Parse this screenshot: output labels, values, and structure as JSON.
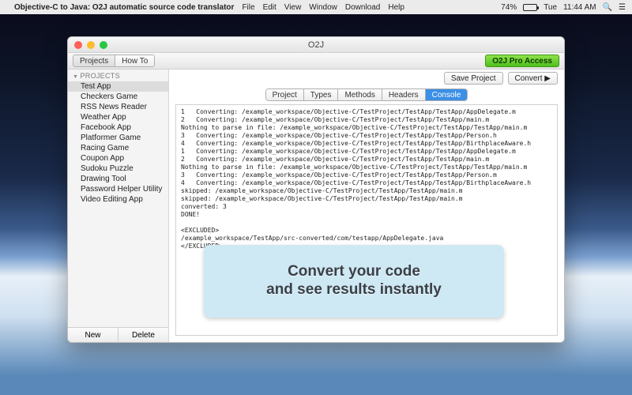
{
  "menubar": {
    "app_title": "Objective-C to Java: O2J automatic source code translator",
    "items": [
      "File",
      "Edit",
      "View",
      "Window",
      "Download",
      "Help"
    ],
    "battery_pct": "74%",
    "day": "Tue",
    "time": "11:44 AM"
  },
  "window": {
    "title": "O2J",
    "toolbar": {
      "tabs": [
        "Projects",
        "How To"
      ],
      "active_tab": 0,
      "pro_button": "O2J Pro Access"
    },
    "action_buttons": {
      "save": "Save Project",
      "convert": "Convert ▶"
    },
    "content_tabs": {
      "items": [
        "Project",
        "Types",
        "Methods",
        "Headers",
        "Console"
      ],
      "active": 4
    }
  },
  "sidebar": {
    "header": "PROJECTS",
    "items": [
      "Test App",
      "Checkers Game",
      "RSS News Reader",
      "Weather App",
      "Facebook App",
      "Platformer Game",
      "Racing Game",
      "Coupon App",
      "Sudoku Puzzle",
      "Drawing Tool",
      "Password Helper Utility",
      "Video Editing App"
    ],
    "selected": 0,
    "new_btn": "New",
    "delete_btn": "Delete"
  },
  "console_lines": [
    "1   Converting: /example_workspace/Objective-C/TestProject/TestApp/TestApp/AppDelegate.m",
    "2   Converting: /example_workspace/Objective-C/TestProject/TestApp/TestApp/main.m",
    "Nothing to parse in file: /example_workspace/Objective-C/TestProject/TestApp/TestApp/main.m",
    "3   Converting: /example_workspace/Objective-C/TestProject/TestApp/TestApp/Person.h",
    "4   Converting: /example_workspace/Objective-C/TestProject/TestApp/TestApp/BirthplaceAware.h",
    "1   Converting: /example_workspace/Objective-C/TestProject/TestApp/TestApp/AppDelegate.m",
    "2   Converting: /example_workspace/Objective-C/TestProject/TestApp/TestApp/main.m",
    "Nothing to parse in file: /example_workspace/Objective-C/TestProject/TestApp/TestApp/main.m",
    "3   Converting: /example_workspace/Objective-C/TestProject/TestApp/TestApp/Person.m",
    "4   Converting: /example_workspace/Objective-C/TestProject/TestApp/TestApp/BirthplaceAware.h",
    "skipped: /example_workspace/Objective-C/TestProject/TestApp/TestApp/main.m",
    "skipped: /example_workspace/Objective-C/TestProject/TestApp/TestApp/main.m",
    "converted: 3",
    "DONE!",
    "",
    "<EXCLUDED>",
    "/example_workspace/TestApp/src-converted/com/testapp/AppDelegate.java",
    "</EXCLUDED>"
  ],
  "callout": {
    "line1": "Convert your code",
    "line2": "and see results instantly"
  }
}
